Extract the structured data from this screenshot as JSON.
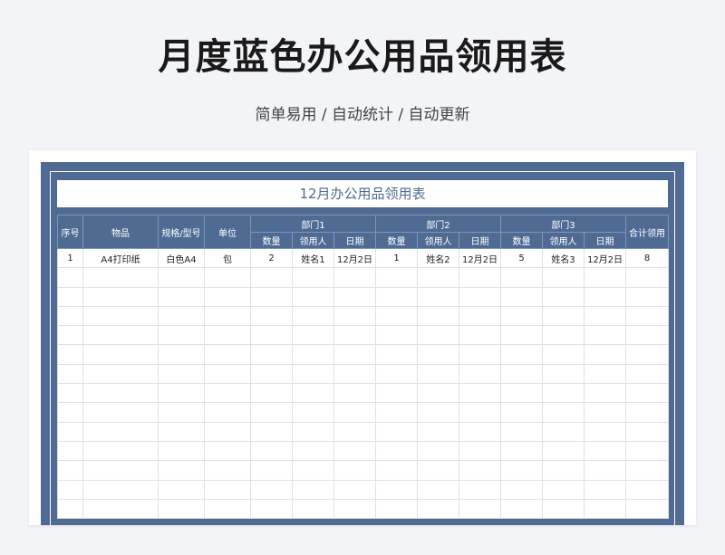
{
  "header": {
    "title": "月度蓝色办公用品领用表",
    "subtitle": "简单易用 / 自动统计 / 自动更新"
  },
  "sheet": {
    "title": "12月办公用品领用表",
    "columns": {
      "seq": "序号",
      "item": "物品",
      "spec": "规格/型号",
      "unit": "单位",
      "dept1": "部门1",
      "dept2": "部门2",
      "dept3": "部门3",
      "total": "合计领用",
      "qty": "数量",
      "receiver": "领用人",
      "date": "日期"
    },
    "rows": [
      [
        "1",
        "A4打印纸",
        "白色A4",
        "包",
        "2",
        "姓名1",
        "12月2日",
        "1",
        "姓名2",
        "12月2日",
        "5",
        "姓名3",
        "12月2日",
        "8"
      ]
    ],
    "empty_row_count": 13
  },
  "colors": {
    "page_background": "#f2f4f7",
    "frame_blue": "#4f6b94",
    "grid_line": "#dde1e7"
  }
}
